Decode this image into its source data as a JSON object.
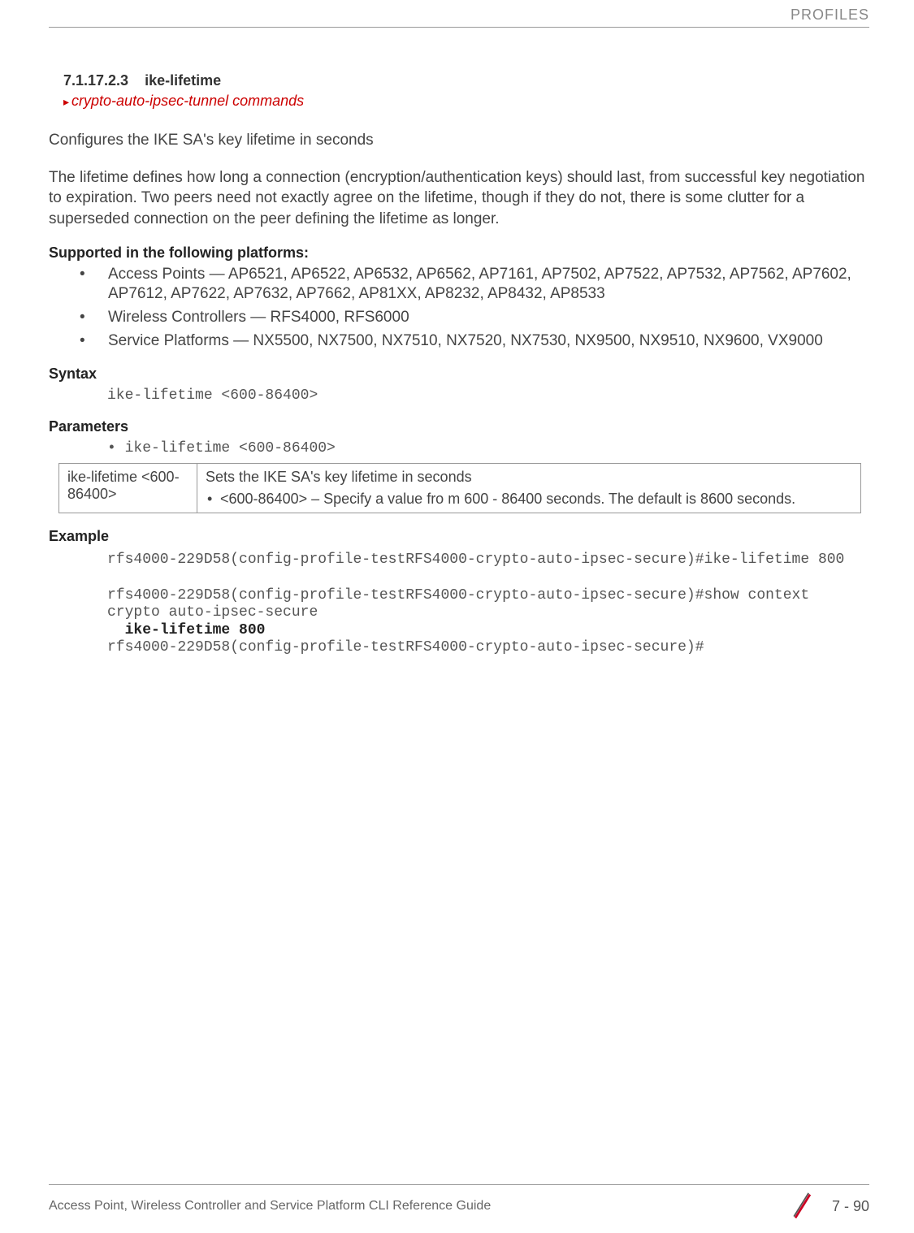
{
  "header": {
    "category": "PROFILES"
  },
  "section": {
    "number": "7.1.17.2.3",
    "title": "ike-lifetime",
    "breadcrumb": "crypto-auto-ipsec-tunnel commands"
  },
  "intro1": "Configures the IKE SA's key lifetime in seconds",
  "intro2": "The lifetime defines how long a connection (encryption/authentication keys) should last, from successful key negotiation to expiration. Two peers need not exactly agree on the lifetime, though if they do not, there is some clutter for a superseded connection on the peer defining the lifetime as longer.",
  "supported": {
    "heading": "Supported in the following platforms:",
    "items": [
      "Access Points — AP6521, AP6522, AP6532, AP6562, AP7161, AP7502, AP7522, AP7532, AP7562, AP7602, AP7612, AP7622, AP7632, AP7662, AP81XX, AP8232, AP8432, AP8533",
      "Wireless Controllers — RFS4000, RFS6000",
      "Service Platforms — NX5500, NX7500, NX7510, NX7520, NX7530, NX9500, NX9510, NX9600, VX9000"
    ]
  },
  "syntax": {
    "heading": "Syntax",
    "code": "ike-lifetime <600-86400>"
  },
  "parameters": {
    "heading": "Parameters",
    "bullet": "• ike-lifetime <600-86400>",
    "table": {
      "param": "ike-lifetime <600-86400>",
      "desc1": "Sets the IKE SA's key lifetime in seconds",
      "desc2": "<600-86400> – Specify a value fro m 600 - 86400 seconds. The default is 8600 seconds."
    }
  },
  "example": {
    "heading": "Example",
    "line1": "rfs4000-229D58(config-profile-testRFS4000-crypto-auto-ipsec-secure)#ike-lifetime 800",
    "line2": "rfs4000-229D58(config-profile-testRFS4000-crypto-auto-ipsec-secure)#show context",
    "line3": "crypto auto-ipsec-secure",
    "line4": "  ike-lifetime 800",
    "line5": "rfs4000-229D58(config-profile-testRFS4000-crypto-auto-ipsec-secure)#"
  },
  "footer": {
    "guide": "Access Point, Wireless Controller and Service Platform CLI Reference Guide",
    "page": "7 - 90"
  }
}
